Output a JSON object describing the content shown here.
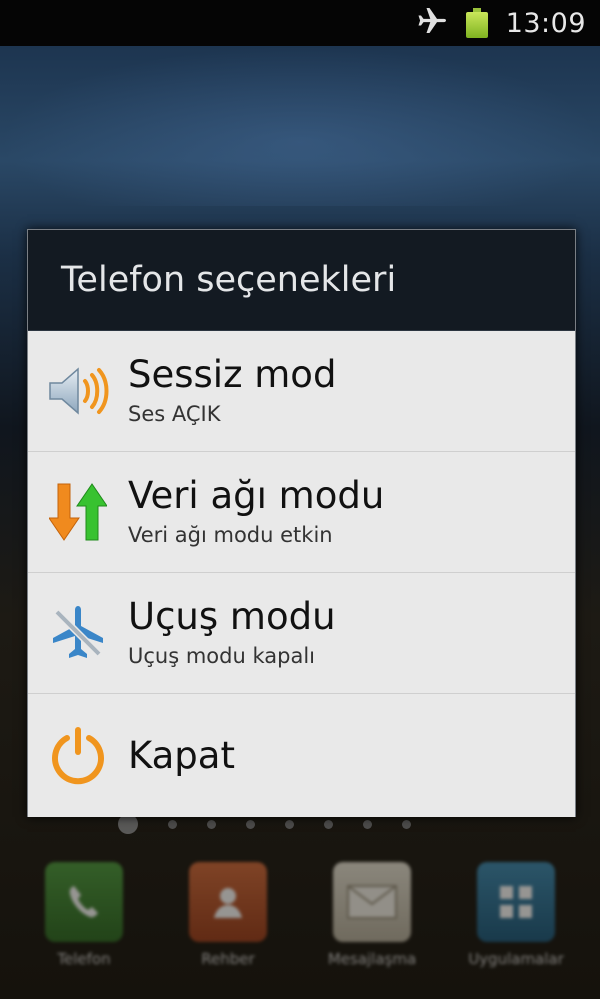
{
  "status_bar": {
    "time": "13:09",
    "icons": [
      "airplane-icon",
      "battery-icon"
    ]
  },
  "dialog": {
    "title": "Telefon seçenekleri",
    "options": [
      {
        "icon": "speaker-icon",
        "title": "Sessiz mod",
        "subtitle": "Ses AÇIK"
      },
      {
        "icon": "data-network-arrows-icon",
        "title": "Veri ağı modu",
        "subtitle": "Veri ağı modu etkin"
      },
      {
        "icon": "airplane-off-icon",
        "title": "Uçuş modu",
        "subtitle": "Uçuş modu kapalı"
      },
      {
        "icon": "power-icon",
        "title": "Kapat"
      }
    ]
  },
  "dock": {
    "items": [
      {
        "icon": "phone-icon",
        "label": "Telefon"
      },
      {
        "icon": "contacts-icon",
        "label": "Rehber"
      },
      {
        "icon": "messages-icon",
        "label": "Mesajlaşma"
      },
      {
        "icon": "apps-icon",
        "label": "Uygulamalar"
      }
    ]
  },
  "colors": {
    "dialog_header": "#131a22",
    "dialog_body": "#e9e9e9",
    "accent_orange": "#f0951e",
    "accent_green": "#38c230",
    "accent_blue": "#3a86c8"
  }
}
